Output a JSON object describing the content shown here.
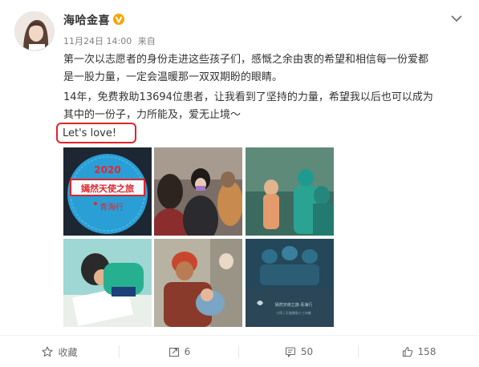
{
  "post": {
    "author": "海哈金喜",
    "verified_badge_icon": "verified-v-icon",
    "time": "11月24日 14:00",
    "source": "来自",
    "paragraph_lines": [
      "第一次以志愿者的身份走进这些孩子们，感慨之余由衷的希望和相信每一份爱都",
      "是一股力量，一定会温暖那一双双期盼的眼睛。",
      "14年，免费救助13694位患者，让我看到了坚持的力量，希望我以后也可以成为",
      "其中的一份子，力所能及，爱无止境～",
      "Let's love!"
    ],
    "badge_photo": {
      "year": "2020",
      "title": "嫣然天使之旅",
      "subtitle": "青海行"
    },
    "photo6_caption_lines": [
      "嫣然天使之旅·青海行",
      "十四 | 天使救助十三年献"
    ]
  },
  "actions": {
    "favorite": {
      "label": "收藏",
      "icon": "star-outline-icon"
    },
    "repost": {
      "count": "6",
      "icon": "repost-icon"
    },
    "comment": {
      "count": "50",
      "icon": "comment-icon"
    },
    "like": {
      "count": "158",
      "icon": "thumbs-up-icon"
    }
  },
  "colors": {
    "highlight_circle": "#e0242a",
    "verified_badge": "#f7a600",
    "badge_bg": "#2a9fd6"
  }
}
